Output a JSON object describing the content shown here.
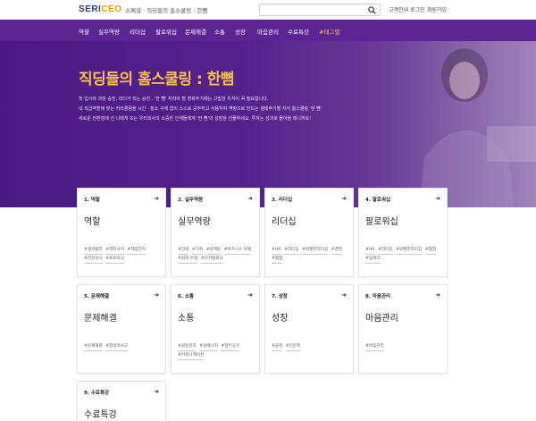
{
  "header": {
    "logo_main": "SERI",
    "logo_accent": "CEO",
    "subtitle": "스페셜 · 직딩들의 홈스쿨링 : 한뼘",
    "util_links": [
      "고객안내",
      "로그인",
      "회원가입"
    ]
  },
  "nav": {
    "items": [
      {
        "label": "역할",
        "active": false
      },
      {
        "label": "실무역량",
        "active": false
      },
      {
        "label": "리더십",
        "active": false
      },
      {
        "label": "팔로워십",
        "active": false
      },
      {
        "label": "문제해결",
        "active": false
      },
      {
        "label": "소통",
        "active": false
      },
      {
        "label": "성장",
        "active": false
      },
      {
        "label": "마음관리",
        "active": false
      },
      {
        "label": "수료특강",
        "active": false
      },
      {
        "label": "#태그별",
        "active": true
      }
    ]
  },
  "hero": {
    "title": "직딩들의 홈스쿨링 : 한뼘",
    "desc_lines": [
      "첫 입사와 과장 승진, 리더가 되는 승진.. '한 뼘' 자라야 할 변화주기에는 고맙한 지식이 꼭 필요합니다.",
      "내 직급역할에 맞는 커리큘럼을 시간 · 장소 구애 없이 스스로 공부하고 사용하여 역량으로 만드는 셀테주기별 지식 홈스쿨링 '한 뼘'",
      "새로운 전환점에 선 나에게 또는 우리회사의 소중한 인재들에게 '한 뼘'의 성장을 선물하세요. 투자는 성과로 돌아올 테니까요!"
    ]
  },
  "cards": [
    {
      "head": "1. 역할",
      "title": "역할",
      "tags": [
        "#생각법칙",
        "#역지사지",
        "#책임전지",
        "#전문의식",
        "#프로의식"
      ]
    },
    {
      "head": "2. 실무역량",
      "title": "실무역량",
      "tags": [
        "#전략",
        "#기획",
        "#마케팅",
        "#비즈니스 모델",
        "#원자 수업",
        "#디지털회사"
      ]
    },
    {
      "head": "3. 리더십",
      "title": "리더십",
      "tags": [
        "#HR",
        "#리더십",
        "#탁월한리더십",
        "#경영",
        "#협업"
      ]
    },
    {
      "head": "4. 팔로워십",
      "title": "팔로워십",
      "tags": [
        "#HR",
        "#리더십",
        "#탁월한리더십",
        "#협업",
        "#팀워크"
      ]
    },
    {
      "head": "5. 문제해결",
      "title": "문제해결",
      "tags": [
        "#문제해결",
        "#창의적사고"
      ]
    },
    {
      "head": "6. 소통",
      "title": "소통",
      "tags": [
        "#갈등관리",
        "#일에너지",
        "#업무공유",
        "#커뮤니케이션"
      ]
    },
    {
      "head": "7. 성장",
      "title": "성장",
      "tags": [
        "#긍정",
        "#인문학"
      ]
    },
    {
      "head": "8. 마음관리",
      "title": "마음관리",
      "tags": [
        "#마음관리"
      ]
    },
    {
      "head": "9. 수료특강",
      "title": "수료특강",
      "tags": []
    }
  ],
  "colors": {
    "nav_bg": "#5b2593",
    "hero_bg": "#4f1f86",
    "hero_title": "#f6c244",
    "logo_main": "#2a3a7a",
    "logo_accent": "#e0a000"
  },
  "icons": {
    "search": "search-icon",
    "card_arrow": "arrow-right-icon"
  }
}
